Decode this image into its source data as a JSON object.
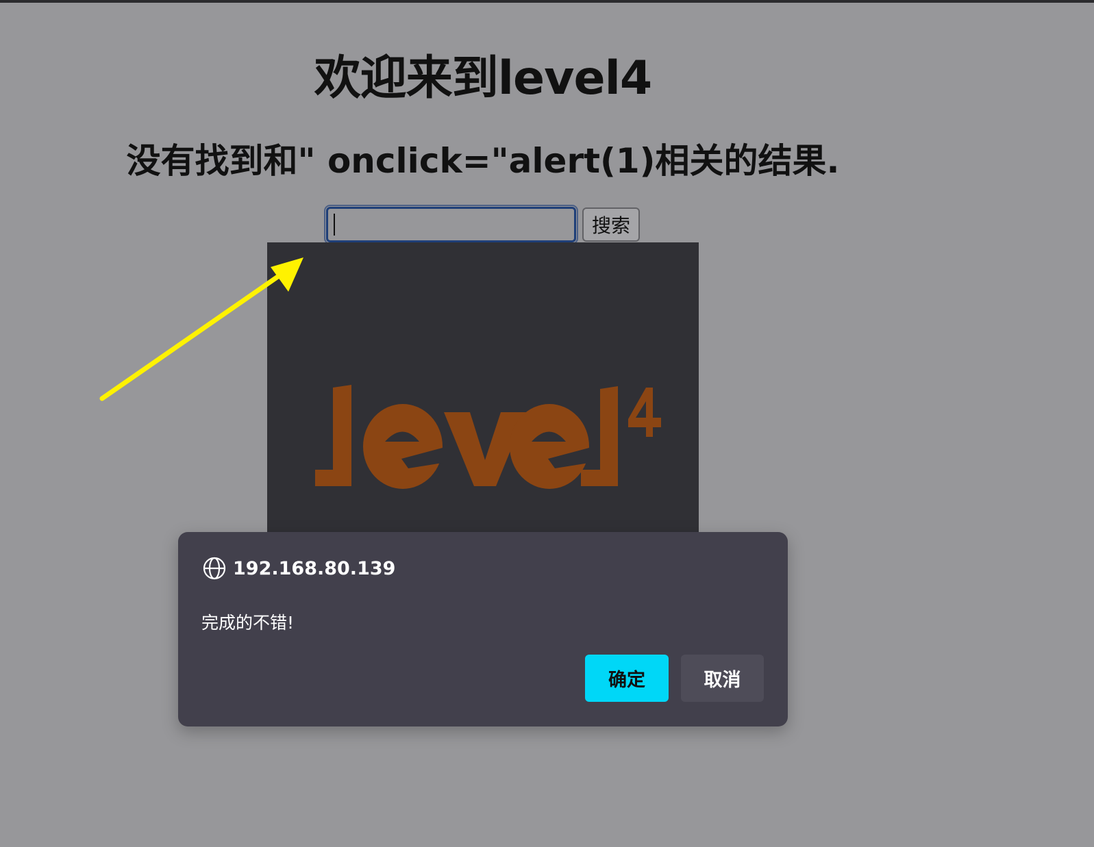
{
  "page": {
    "heading": "欢迎来到level4",
    "result_message": "没有找到和\" onclick=\"alert(1)相关的结果.",
    "background_color": "#97979a"
  },
  "search": {
    "value": "",
    "button_label": "搜索"
  },
  "level_image": {
    "logo_text": "level",
    "logo_superscript": "4",
    "logo_color": "#8b4513",
    "background_color": "#303035"
  },
  "annotation": {
    "icon": "arrow-icon",
    "color": "#fff200"
  },
  "alert": {
    "origin_icon": "globe-icon",
    "origin": "192.168.80.139",
    "message": "完成的不错!",
    "ok_label": "确定",
    "cancel_label": "取消",
    "accent_color": "#00d7f7",
    "background_color": "#42404c"
  }
}
